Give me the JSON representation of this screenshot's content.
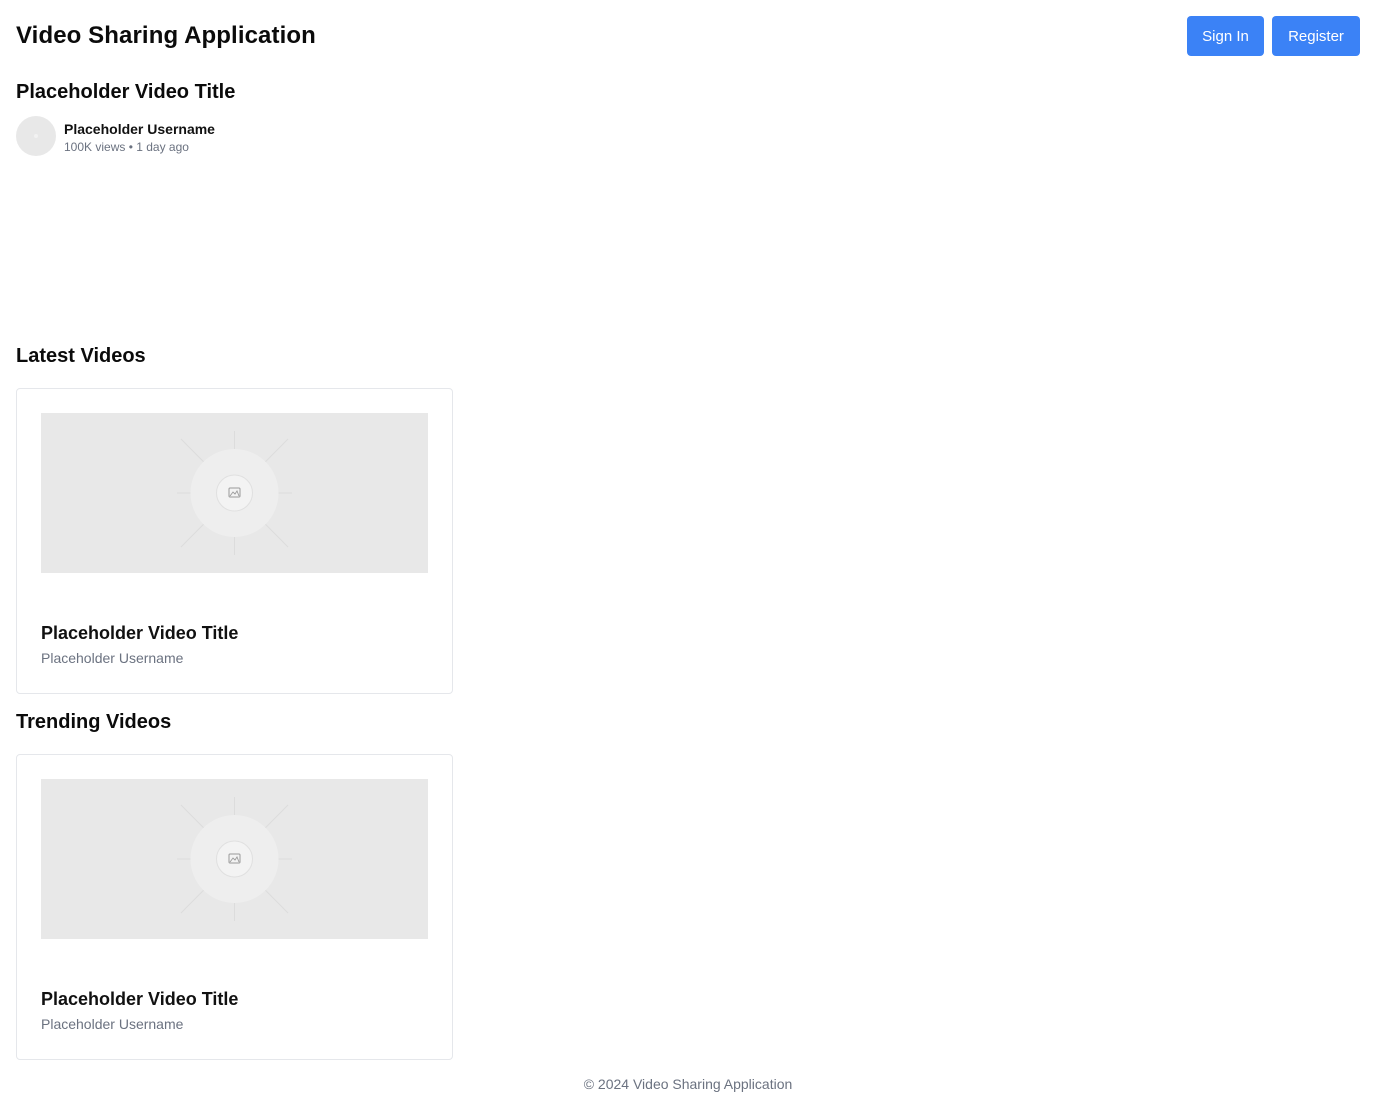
{
  "header": {
    "app_title": "Video Sharing Application",
    "sign_in_label": "Sign In",
    "register_label": "Register"
  },
  "current_video": {
    "title": "Placeholder Video Title",
    "username": "Placeholder Username",
    "stats": "100K views • 1 day ago"
  },
  "latest": {
    "heading": "Latest Videos",
    "videos": [
      {
        "title": "Placeholder Video Title",
        "username": "Placeholder Username"
      }
    ]
  },
  "trending": {
    "heading": "Trending Videos",
    "videos": [
      {
        "title": "Placeholder Video Title",
        "username": "Placeholder Username"
      }
    ]
  },
  "footer": {
    "text": "© 2024 Video Sharing Application"
  },
  "colors": {
    "accent": "#3b82f6",
    "placeholder_bg": "#e8e8e8",
    "muted_text": "#6b7280",
    "border": "#e5e7eb"
  },
  "icons": {
    "thumbnail": "image-placeholder-icon",
    "avatar": "avatar-placeholder"
  }
}
